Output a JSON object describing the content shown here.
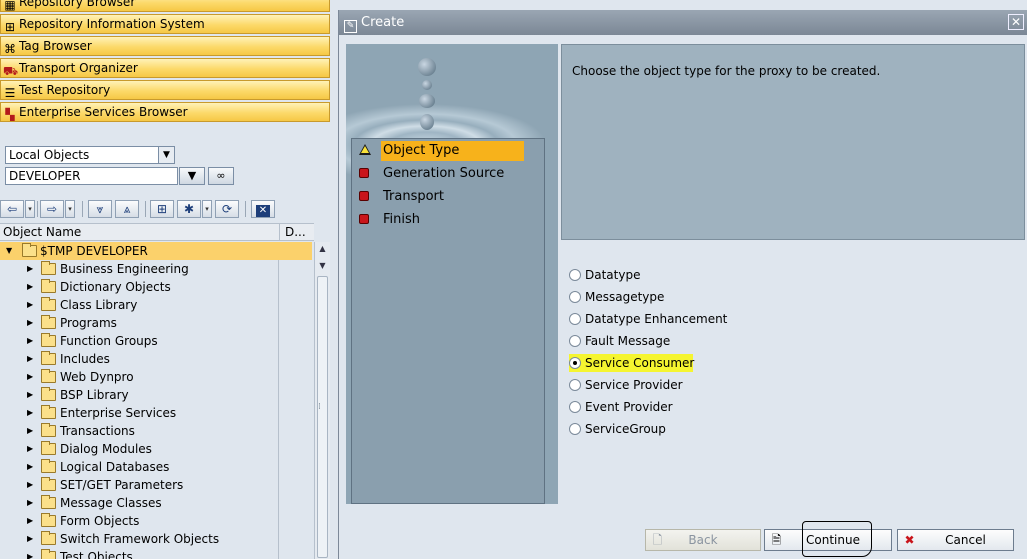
{
  "left": {
    "nav_buttons": [
      {
        "label": "Repository Browser",
        "icon": "repository-icon"
      },
      {
        "label": "Repository Information System",
        "icon": "hierarchy-icon"
      },
      {
        "label": "Tag Browser",
        "icon": "tag-icon"
      },
      {
        "label": "Transport Organizer",
        "icon": "truck-icon"
      },
      {
        "label": "Test Repository",
        "icon": "test-icon"
      },
      {
        "label": "Enterprise Services Browser",
        "icon": "grid-icon"
      }
    ],
    "object_list_select": "Local Objects",
    "user_input": "DEVELOPER",
    "tree_header": {
      "col1": "Object Name",
      "col2": "D..."
    },
    "tree_root": "$TMP DEVELOPER",
    "tree_items": [
      "Business Engineering",
      "Dictionary Objects",
      "Class Library",
      "Programs",
      "Function Groups",
      "Includes",
      "Web Dynpro",
      "BSP Library",
      "Enterprise Services",
      "Transactions",
      "Dialog Modules",
      "Logical Databases",
      "SET/GET Parameters",
      "Message Classes",
      "Form Objects",
      "Switch Framework Objects",
      "Test Objects"
    ]
  },
  "dialog": {
    "title": "Create",
    "steps": [
      {
        "label": "Object Type",
        "status": "warning",
        "active": true
      },
      {
        "label": "Generation Source",
        "status": "error",
        "active": false
      },
      {
        "label": "Transport",
        "status": "error",
        "active": false
      },
      {
        "label": "Finish",
        "status": "error",
        "active": false
      }
    ],
    "message": "Choose the object type for the proxy to be created.",
    "options": [
      {
        "label": "Datatype",
        "selected": false
      },
      {
        "label": "Messagetype",
        "selected": false
      },
      {
        "label": "Datatype Enhancement",
        "selected": false
      },
      {
        "label": "Fault Message",
        "selected": false
      },
      {
        "label": "Service Consumer",
        "selected": true
      },
      {
        "label": "Service Provider",
        "selected": false
      },
      {
        "label": "Event Provider",
        "selected": false
      },
      {
        "label": "ServiceGroup",
        "selected": false
      }
    ],
    "buttons": {
      "back": "Back",
      "continue": "Continue",
      "cancel": "Cancel"
    }
  },
  "colors": {
    "highlight": "#f5f530",
    "active_step": "#f7b21b",
    "nav_button": "#fcd96a",
    "error_status": "#c9151b"
  }
}
